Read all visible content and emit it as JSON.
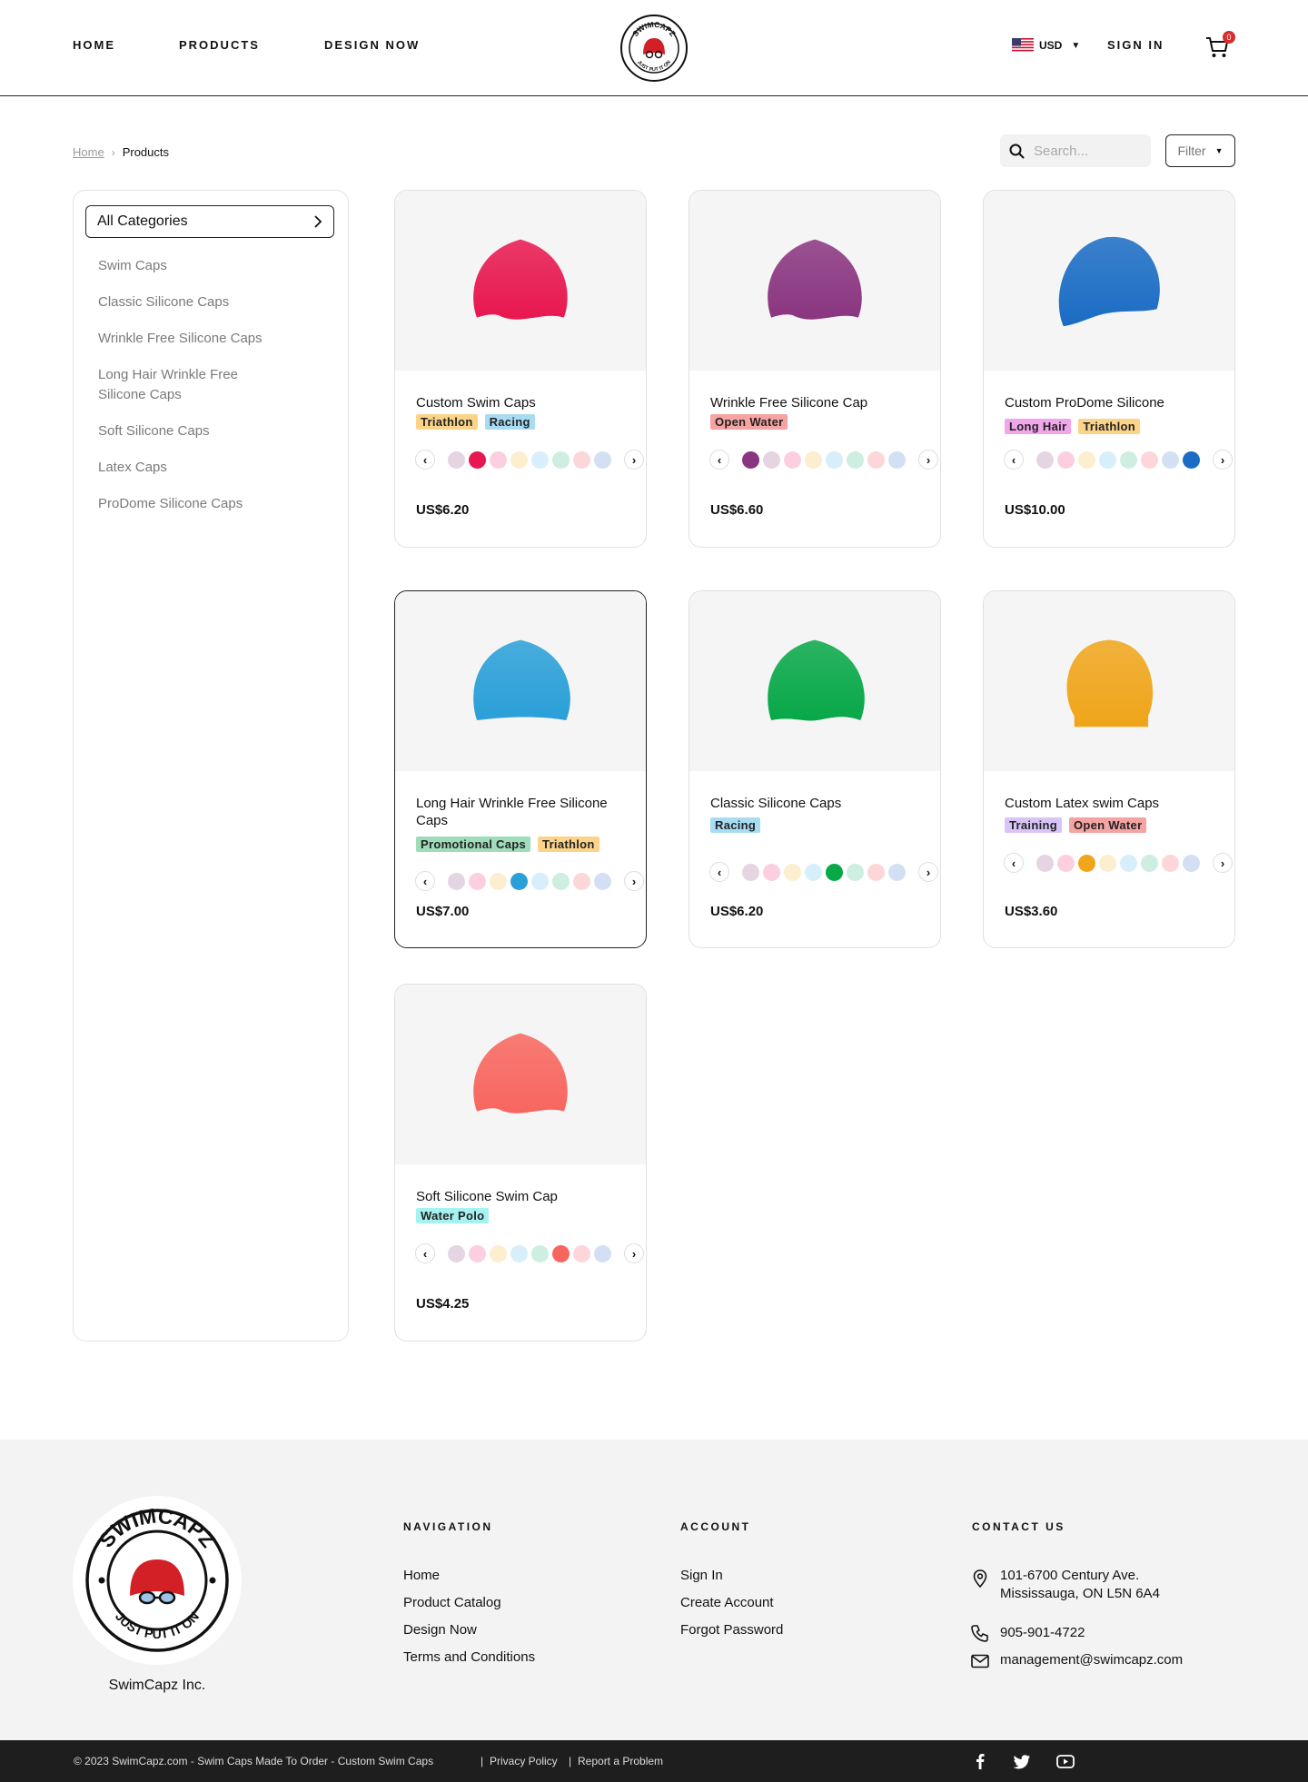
{
  "header": {
    "nav": [
      "HOME",
      "PRODUCTS",
      "DESIGN NOW"
    ],
    "logo_text": "SWIMCAPZ",
    "logo_tagline": "JUST PUT IT ON",
    "currency": "USD",
    "sign_in": "SIGN IN",
    "cart_count": "0"
  },
  "breadcrumb": {
    "home": "Home",
    "current": "Products"
  },
  "search": {
    "placeholder": "Search..."
  },
  "filter": {
    "label": "Filter"
  },
  "sidebar": {
    "all_categories": "All Categories",
    "categories": [
      "Swim Caps",
      "Classic Silicone Caps",
      "Wrinkle Free Silicone Caps",
      "Long Hair Wrinkle Free Silicone Caps",
      "Soft Silicone Caps",
      "Latex Caps",
      "ProDome Silicone Caps"
    ]
  },
  "products": [
    {
      "name": "Custom Swim Caps",
      "tags": [
        "Triathlon",
        "Racing"
      ],
      "price": "US$6.20",
      "color": "#e8174f",
      "selected_swatch": 1
    },
    {
      "name": "Wrinkle Free Silicone Cap",
      "tags": [
        "Open Water"
      ],
      "price": "US$6.60",
      "color": "#8a3580",
      "selected_swatch": 0
    },
    {
      "name": "Custom ProDome Silicone",
      "tags": [
        "Long Hair",
        "Triathlon"
      ],
      "price": "US$10.00",
      "color": "#1a6cc4",
      "selected_swatch": 7
    },
    {
      "name": "Long Hair Wrinkle Free Silicone Caps",
      "tags": [
        "Promotional Caps",
        "Triathlon"
      ],
      "price": "US$7.00",
      "color": "#2a9fd8",
      "selected_swatch": 3
    },
    {
      "name": "Classic Silicone Caps",
      "tags": [
        "Racing"
      ],
      "price": "US$6.20",
      "color": "#07a848",
      "selected_swatch": 4
    },
    {
      "name": "Custom Latex swim Caps",
      "tags": [
        "Training",
        "Open Water"
      ],
      "price": "US$3.60",
      "color": "#f0a51a",
      "selected_swatch": 2
    },
    {
      "name": "Soft Silicone Swim Cap",
      "tags": [
        "Water Polo"
      ],
      "price": "US$4.25",
      "color": "#f7665e",
      "selected_swatch": 5
    }
  ],
  "tag_colors": {
    "Triathlon": "#fbd48a",
    "Racing": "#a8dcf3",
    "Open Water": "#f6a3a3",
    "Long Hair": "#f1a6ec",
    "Promotional Caps": "#9fdcb9",
    "Training": "#d8c4f6",
    "Water Polo": "#a5f2f0"
  },
  "swatches": [
    "#e5d5e3",
    "#fccfe0",
    "#fbefcf",
    "#d7eefb",
    "#cdeee0",
    "#fdd6da",
    "#d3e0f3"
  ],
  "footer": {
    "company": "SwimCapz Inc.",
    "navigation_heading": "NAVIGATION",
    "navigation": [
      "Home",
      "Product Catalog",
      "Design Now",
      "Terms and Conditions"
    ],
    "account_heading": "ACCOUNT",
    "account": [
      "Sign In",
      "Create Account",
      "Forgot Password"
    ],
    "contact_heading": "CONTACT US",
    "address_line1": "101-6700 Century Ave.",
    "address_line2": "Mississauga, ON L5N 6A4",
    "phone": "905-901-4722",
    "email": "management@swimcapz.com"
  },
  "bottom_bar": {
    "copyright": "© 2023 SwimCapz.com  -  Swim Caps Made To Order  -  Custom Swim Caps",
    "privacy": "Privacy Policy",
    "report": "Report a Problem"
  }
}
